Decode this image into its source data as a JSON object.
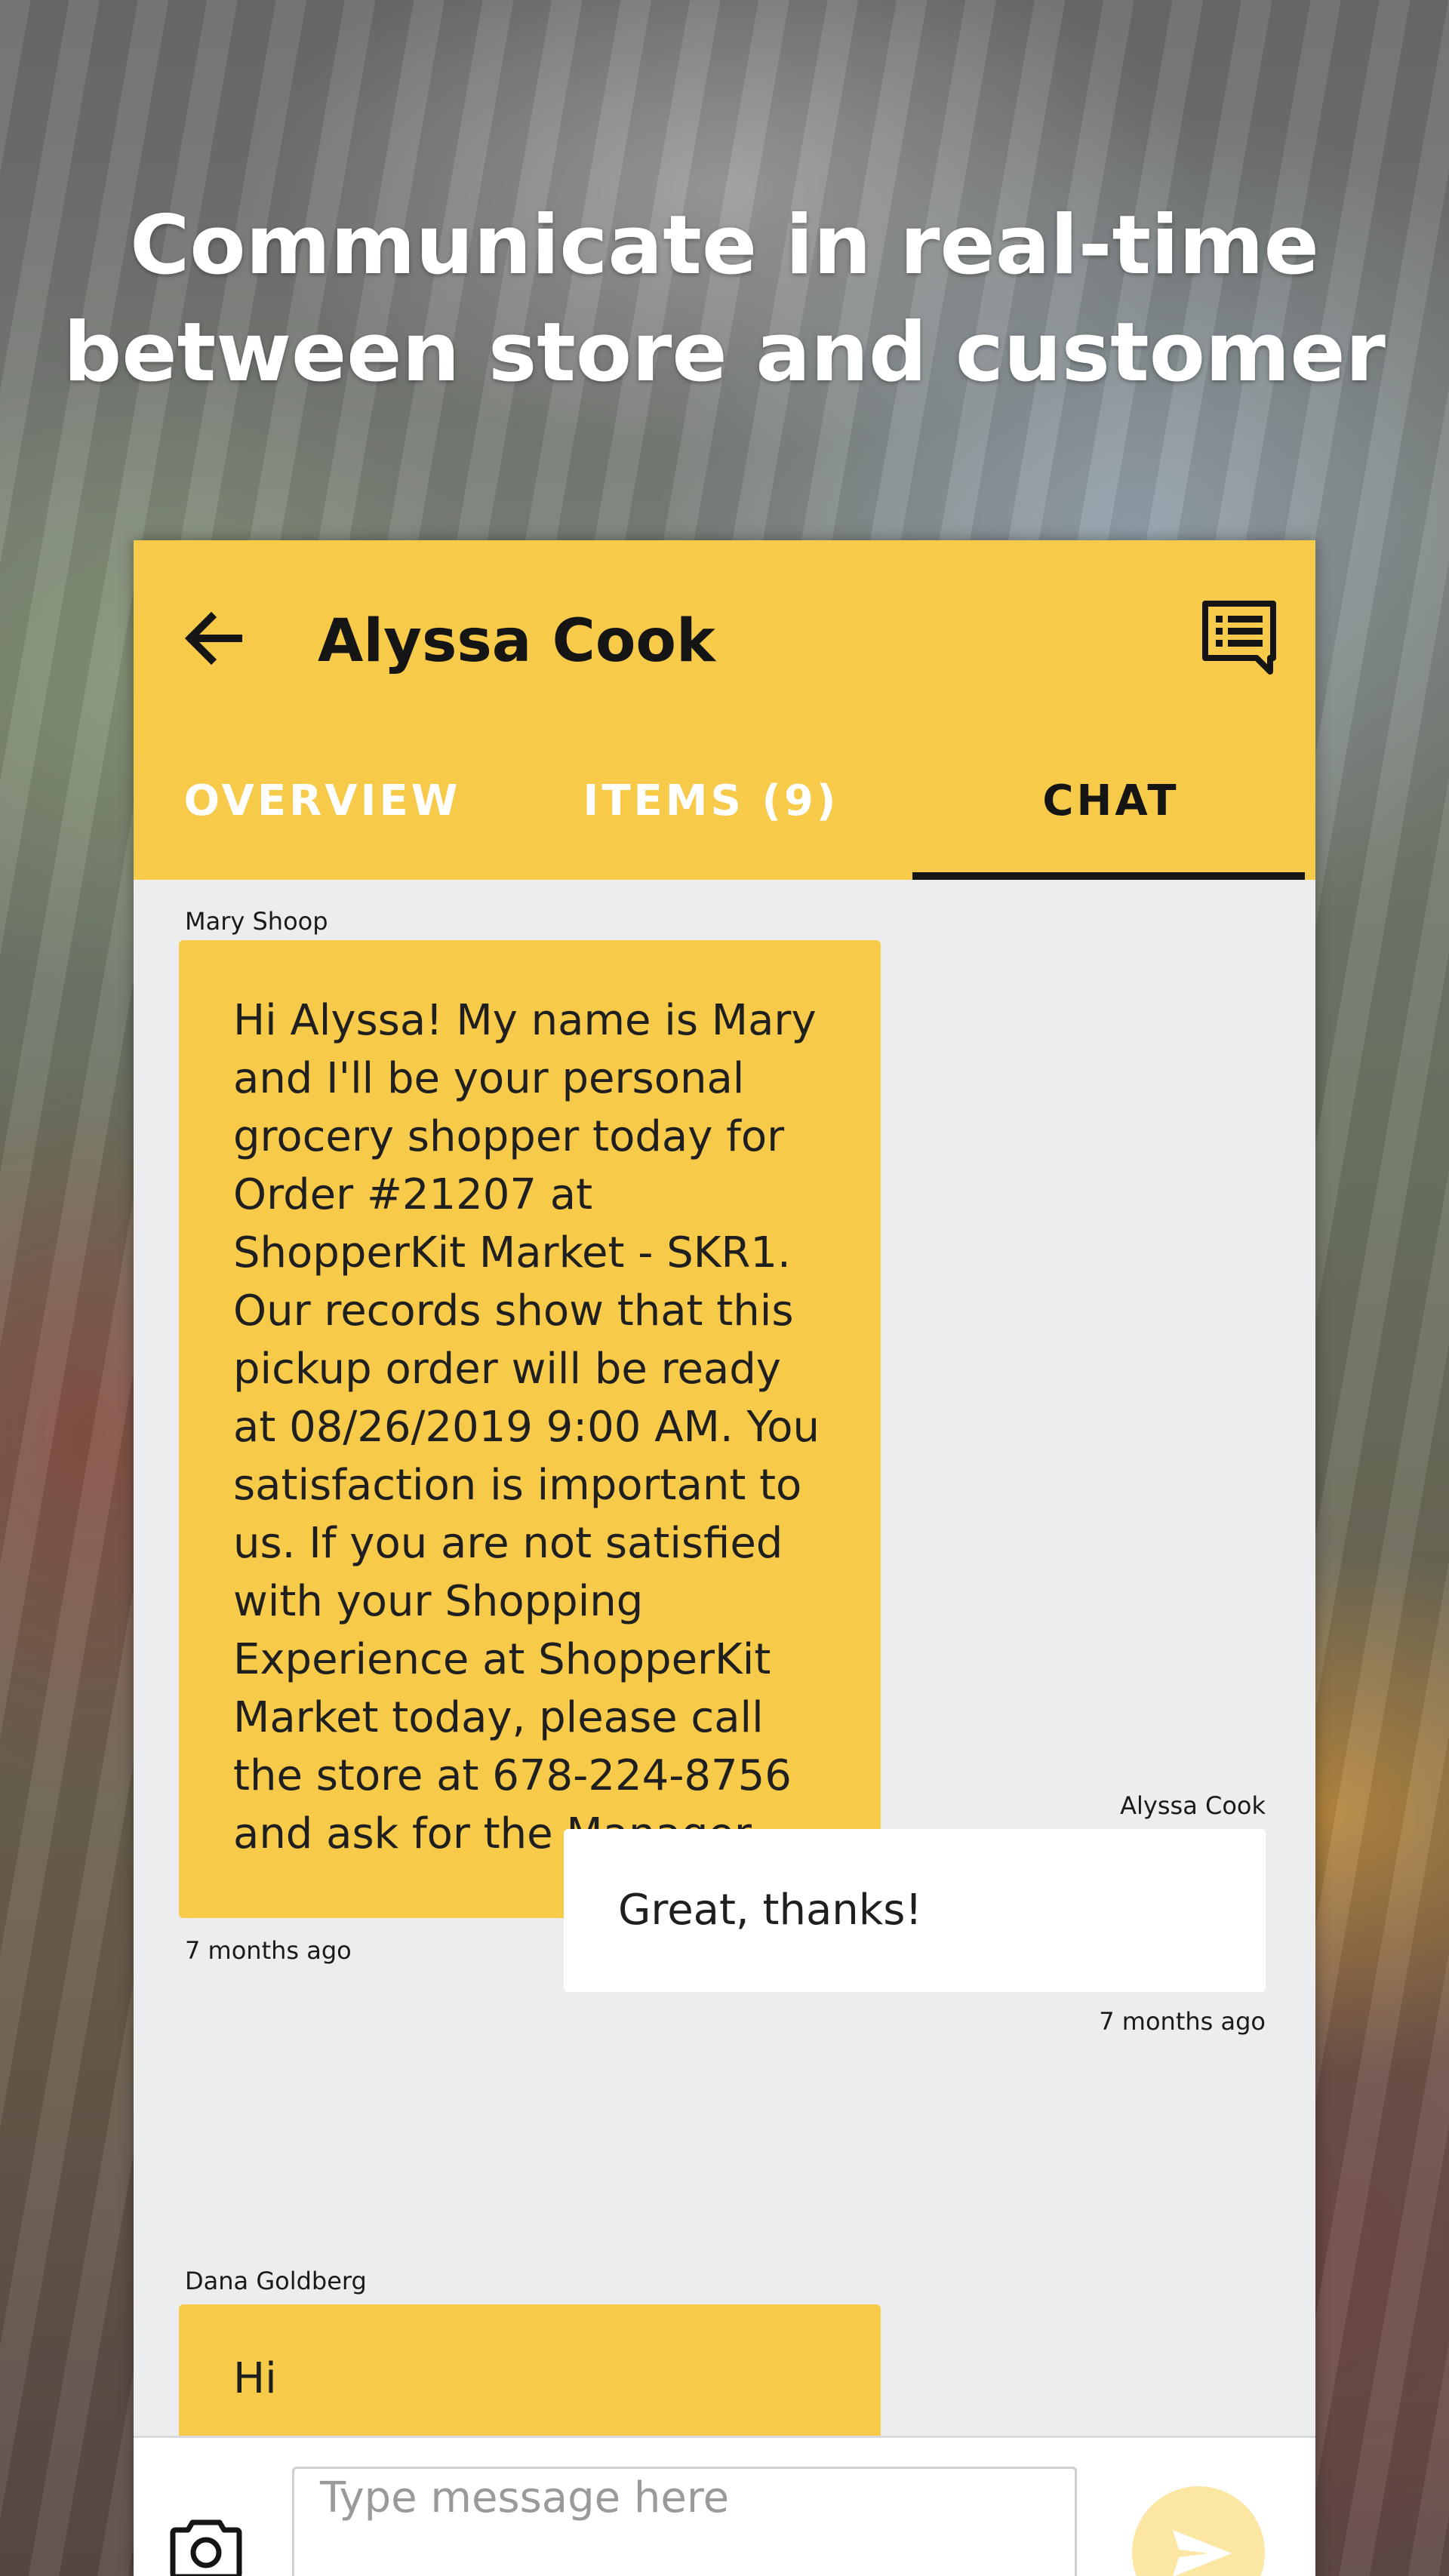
{
  "headline": {
    "line1": "Communicate in real-time",
    "line2": "between store and customer"
  },
  "header": {
    "title": "Alyssa Cook",
    "back_icon": "arrow-back-icon",
    "notes_icon": "notes-icon"
  },
  "tabs": [
    {
      "label": "OVERVIEW",
      "active": false
    },
    {
      "label": "ITEMS (9)",
      "active": false
    },
    {
      "label": "CHAT",
      "active": true
    }
  ],
  "messages": [
    {
      "sender": "Mary Shoop",
      "text": "Hi Alyssa! My name is Mary and I'll be your personal grocery shopper today for Order #21207 at ShopperKit Market - SKR1. Our records show that this pickup order will be ready at 08/26/2019 9:00 AM. You satisfaction is important to us. If you are not satisfied with your Shopping Experience at ShopperKit Market today, please call the store at 678-224-8756 and ask for the Manager.",
      "time": "7 months ago",
      "read_icon": "double-check-icon"
    },
    {
      "sender": "Alyssa Cook",
      "text": "Great, thanks!",
      "time": "7 months ago"
    },
    {
      "sender": "Dana Goldberg",
      "text": "Hi"
    }
  ],
  "composer": {
    "placeholder": "Type message here",
    "camera_icon": "camera-icon",
    "send_icon": "send-icon"
  },
  "colors": {
    "accent": "#f7ca4a",
    "chat_background": "#ecedef",
    "send_button": "#fbe6a3"
  }
}
